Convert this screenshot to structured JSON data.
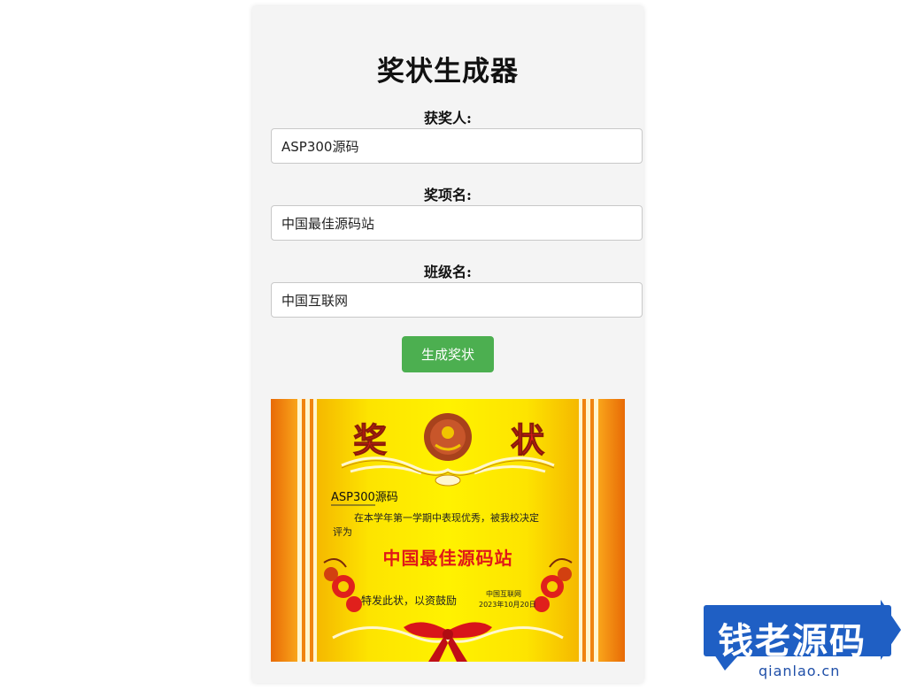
{
  "page": {
    "title": "奖状生成器"
  },
  "form": {
    "awardee_label": "获奖人:",
    "awardee_value": "ASP300源码",
    "award_label": "奖项名:",
    "award_value": "中国最佳源码站",
    "class_label": "班级名:",
    "class_value": "中国互联网",
    "generate_label": "生成奖状"
  },
  "certificate": {
    "heading_left": "奖",
    "heading_right": "状",
    "name": "ASP300源码",
    "line1": "在本学年第一学期中表现优秀，被我校决定",
    "line2": "评为",
    "award": "中国最佳源码站",
    "footer": "特发此状，以资鼓励",
    "issuer": "中国互联网",
    "date": "2023年10月20日",
    "colors": {
      "background_yellow": "#fde000",
      "border_orange": "#ee7a0a",
      "heading_red": "#e31b1b",
      "award_red": "#e01818"
    }
  },
  "watermark": {
    "text": "钱老源码",
    "url": "qianlao.cn",
    "color": "#1f5fc4"
  },
  "theme": {
    "button_green": "#4caf50",
    "card_bg": "#f4f4f4"
  }
}
